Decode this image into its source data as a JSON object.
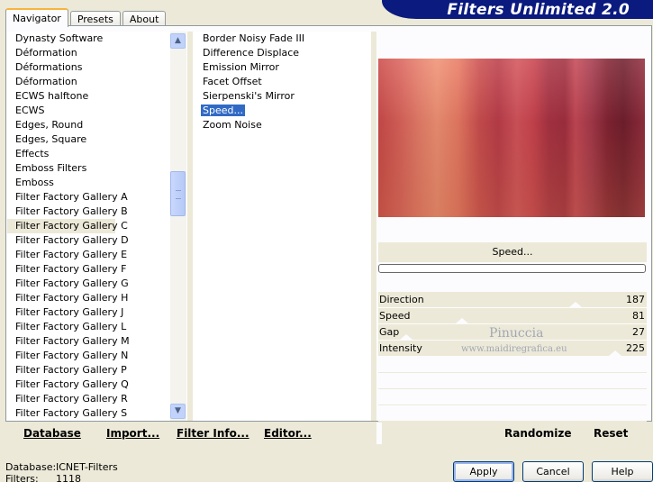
{
  "tabs": [
    "Navigator",
    "Presets",
    "About"
  ],
  "banner": "Filters Unlimited 2.0",
  "categories": [
    "Dynasty Software",
    "Déformation",
    "Déformations",
    "Déformation",
    "ECWS halftone",
    "ECWS",
    "Edges, Round",
    "Edges, Square",
    "Effects",
    "Emboss Filters",
    "Emboss",
    "Filter Factory Gallery A",
    "Filter Factory Gallery B",
    "Filter Factory Gallery C",
    "Filter Factory Gallery D",
    "Filter Factory Gallery E",
    "Filter Factory Gallery F",
    "Filter Factory Gallery G",
    "Filter Factory Gallery H",
    "Filter Factory Gallery J",
    "Filter Factory Gallery L",
    "Filter Factory Gallery M",
    "Filter Factory Gallery N",
    "Filter Factory Gallery P",
    "Filter Factory Gallery Q",
    "Filter Factory Gallery R",
    "Filter Factory Gallery S"
  ],
  "selected_category_index": 13,
  "filters": [
    "Border Noisy Fade III",
    "Difference Displace",
    "Emission Mirror",
    "Facet Offset",
    "Sierpenski's Mirror",
    "Speed...",
    "Zoom Noise"
  ],
  "selected_filter_index": 5,
  "filter_name": "Speed...",
  "params": [
    {
      "name": "Direction",
      "value": "187"
    },
    {
      "name": "Speed",
      "value": "81"
    },
    {
      "name": "Gap",
      "value": "27"
    },
    {
      "name": "Intensity",
      "value": "225"
    }
  ],
  "watermark": {
    "line1": "Pinuccia",
    "line2": "www.maidiregrafica.eu"
  },
  "toolbar": {
    "database": "Database",
    "import": "Import...",
    "filter_info": "Filter Info...",
    "editor": "Editor...",
    "randomize": "Randomize",
    "reset": "Reset"
  },
  "status": {
    "database_label": "Database:",
    "database_value": "ICNET-Filters",
    "filters_label": "Filters:",
    "filters_value": "1118"
  },
  "buttons": {
    "apply": "Apply",
    "cancel": "Cancel",
    "help": "Help"
  },
  "icons": {
    "scroll_up": "chevron-up-icon",
    "scroll_down": "chevron-down-icon"
  }
}
